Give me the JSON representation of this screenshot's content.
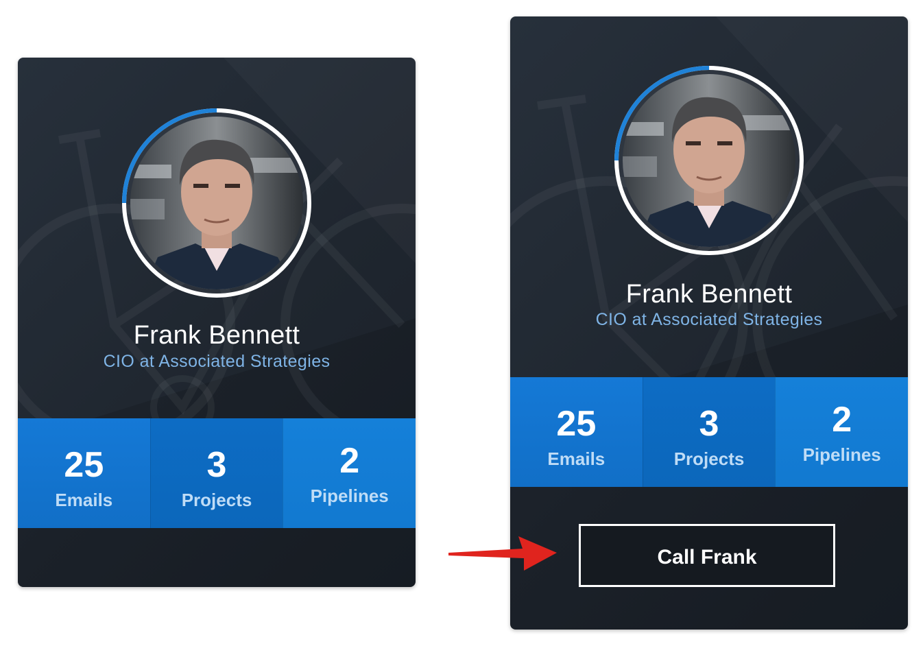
{
  "cards": [
    {
      "name": "Frank Bennett",
      "title": "CIO at Associated Strategies",
      "progress": 0.25,
      "stats": [
        {
          "value": "25",
          "label": "Emails"
        },
        {
          "value": "3",
          "label": "Projects"
        },
        {
          "value": "2",
          "label": "Pipelines"
        }
      ]
    },
    {
      "name": "Frank Bennett",
      "title": "CIO at Associated Strategies",
      "progress": 0.25,
      "stats": [
        {
          "value": "25",
          "label": "Emails"
        },
        {
          "value": "3",
          "label": "Projects"
        },
        {
          "value": "2",
          "label": "Pipelines"
        }
      ],
      "call_button": "Call Frank"
    }
  ],
  "colors": {
    "accent": "#0f74d0",
    "progress_ring": "#1f82d8",
    "title_text": "#7fb4e6",
    "arrow": "#e0241e"
  },
  "icons": [
    "avatar",
    "pointer-arrow-icon"
  ]
}
